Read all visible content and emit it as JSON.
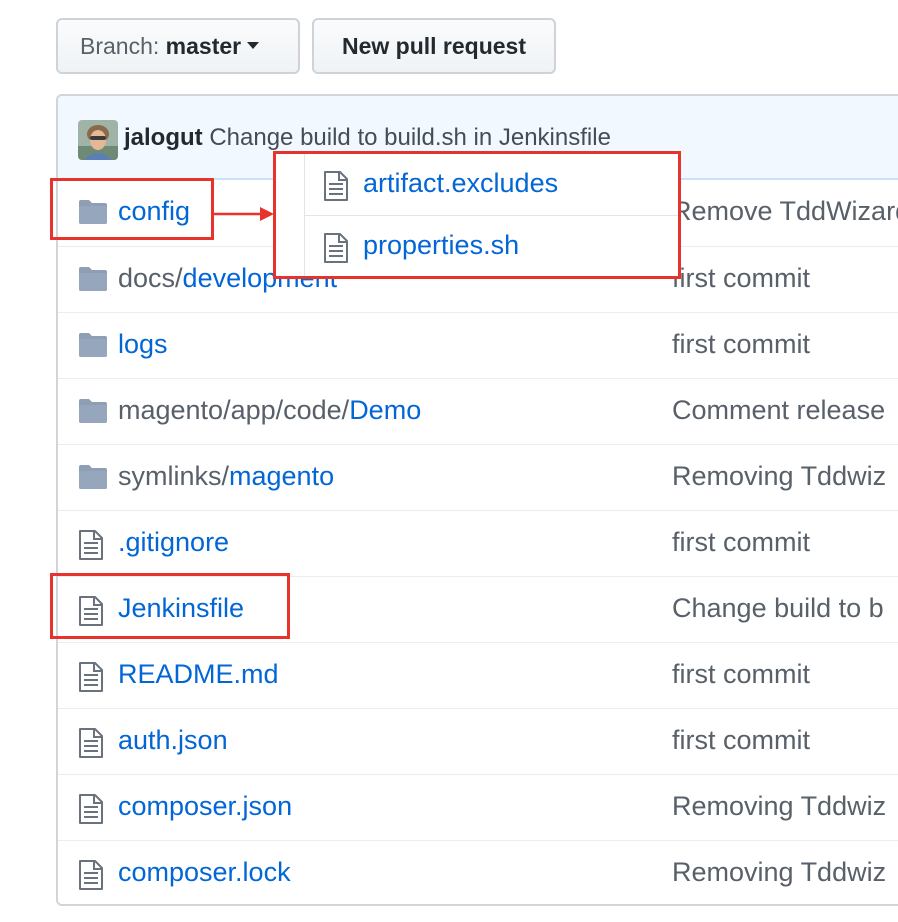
{
  "toolbar": {
    "branch_label": "Branch:",
    "branch_name": "master",
    "new_pr_label": "New pull request"
  },
  "latest_commit": {
    "author": "jalogut",
    "message": "Change build to build.sh in Jenkinsfile"
  },
  "files": [
    {
      "type": "dir",
      "prefix": "",
      "name": "config",
      "message": "Remove TddWizard"
    },
    {
      "type": "dir",
      "prefix": "docs/",
      "name": "development",
      "message": "first commit"
    },
    {
      "type": "dir",
      "prefix": "",
      "name": "logs",
      "message": "first commit"
    },
    {
      "type": "dir",
      "prefix": "magento/app/code/",
      "name": "Demo",
      "message": "Comment release"
    },
    {
      "type": "dir",
      "prefix": "symlinks/",
      "name": "magento",
      "message": "Removing Tddwiz"
    },
    {
      "type": "file",
      "prefix": "",
      "name": ".gitignore",
      "message": "first commit"
    },
    {
      "type": "file",
      "prefix": "",
      "name": "Jenkinsfile",
      "message": "Change build to b"
    },
    {
      "type": "file",
      "prefix": "",
      "name": "README.md",
      "message": "first commit"
    },
    {
      "type": "file",
      "prefix": "",
      "name": "auth.json",
      "message": "first commit"
    },
    {
      "type": "file",
      "prefix": "",
      "name": "composer.json",
      "message": "Removing Tddwiz"
    },
    {
      "type": "file",
      "prefix": "",
      "name": "composer.lock",
      "message": "Removing Tddwiz"
    }
  ],
  "config_contents": [
    {
      "name": "artifact.excludes"
    },
    {
      "name": "properties.sh"
    }
  ],
  "colors": {
    "link": "#0366d6",
    "muted": "#586069",
    "folder": "#79b8ff",
    "annotation": "#e8322c",
    "commit_bar": "#f1f8ff"
  },
  "icons": {
    "dir": "folder-icon",
    "file": "file-icon"
  }
}
